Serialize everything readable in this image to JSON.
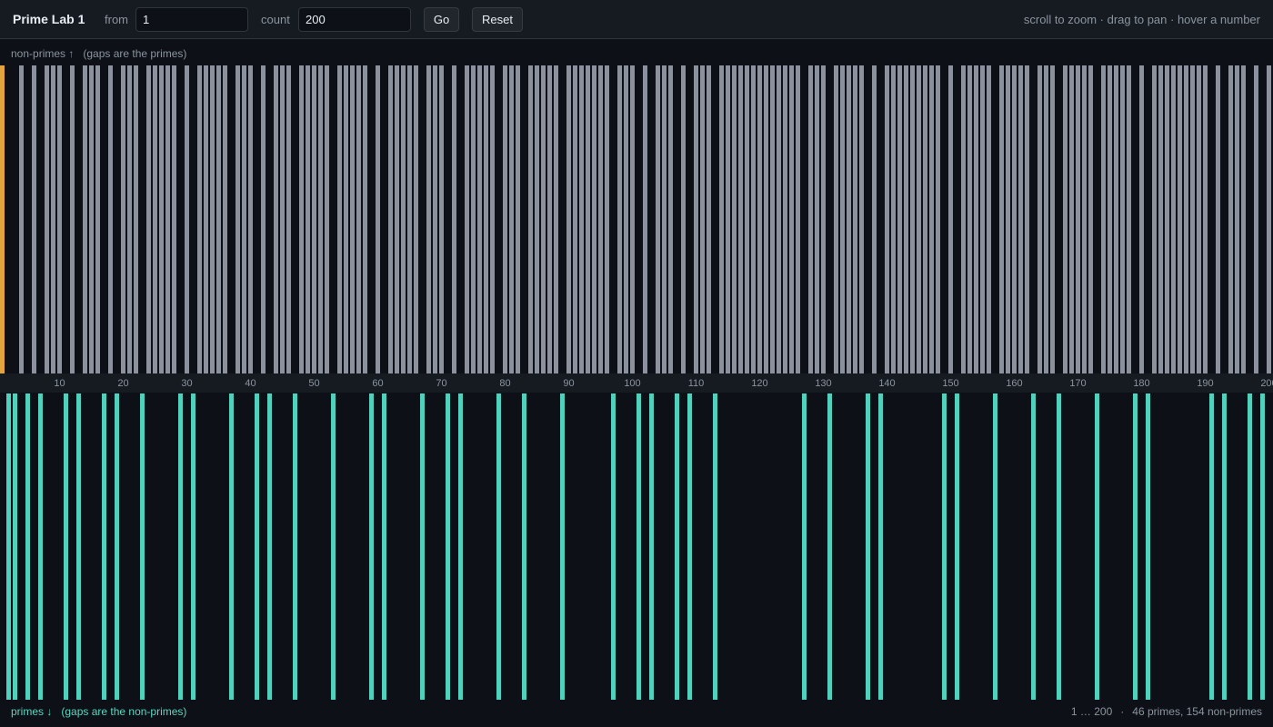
{
  "toolbar": {
    "title": "Prime Lab 1",
    "from_label": "from",
    "from_value": "1",
    "count_label": "count",
    "count_value": "200",
    "go_label": "Go",
    "reset_label": "Reset",
    "hint": "scroll to zoom · drag to pan · hover a number"
  },
  "top_panel": {
    "label": "non-primes ↑",
    "sublabel": "(gaps are the primes)"
  },
  "bottom_panel": {
    "label": "primes ↓",
    "sublabel": "(gaps are the non-primes)"
  },
  "footer": {
    "range": "1 … 200",
    "separator": "·",
    "summary": "46 primes, 154 non-primes"
  },
  "colors": {
    "nonprime": "#8b929e",
    "prime": "#4fd1bd",
    "highlight": "#e3a33d",
    "axis_text": "#8b949e"
  },
  "chart_data": {
    "type": "bar",
    "from": 1,
    "count": 200,
    "highlighted_number": 1,
    "primes": [
      2,
      3,
      5,
      7,
      11,
      13,
      17,
      19,
      23,
      29,
      31,
      37,
      41,
      43,
      47,
      53,
      59,
      61,
      67,
      71,
      73,
      79,
      83,
      89,
      97,
      101,
      103,
      107,
      109,
      113,
      127,
      131,
      137,
      139,
      149,
      151,
      157,
      163,
      167,
      173,
      179,
      181,
      191,
      193,
      197,
      199
    ],
    "x_ticks": [
      "10",
      "20",
      "30",
      "40",
      "50",
      "60",
      "70",
      "80",
      "90",
      "100",
      "110",
      "120",
      "130",
      "140",
      "150",
      "160",
      "170",
      "180",
      "190",
      "200"
    ],
    "series": [
      {
        "name": "non-primes",
        "rule": "every number in range not in primes"
      },
      {
        "name": "primes",
        "rule": "numbers listed in primes"
      }
    ]
  }
}
